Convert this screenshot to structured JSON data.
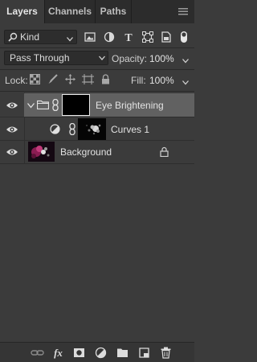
{
  "tabs": [
    {
      "label": "Layers",
      "active": true
    },
    {
      "label": "Channels",
      "active": false
    },
    {
      "label": "Paths",
      "active": false
    }
  ],
  "filter": {
    "kind_label": "Kind",
    "type_icons": [
      "image-filter-icon",
      "adjustment-filter-icon",
      "type-filter-icon",
      "shape-filter-icon",
      "smart-object-filter-icon",
      "filter-toggle"
    ]
  },
  "blend": {
    "mode": "Pass Through",
    "opacity_label": "Opacity:",
    "opacity_value": "100%"
  },
  "lock": {
    "label": "Lock:",
    "icons": [
      "lock-transparent-icon",
      "lock-image-icon",
      "lock-position-icon",
      "lock-artboard-icon",
      "lock-all-icon"
    ],
    "fill_label": "Fill:",
    "fill_value": "100%"
  },
  "layers": [
    {
      "name": "Eye Brightening",
      "type": "group",
      "selected": true
    },
    {
      "name": "Curves 1",
      "type": "adjustment"
    },
    {
      "name": "Background",
      "type": "image",
      "locked": true
    }
  ],
  "bottom_icons": [
    "link-layers-icon",
    "layer-style-fx-icon",
    "add-mask-icon",
    "new-adjustment-layer-icon",
    "new-group-icon",
    "new-layer-icon",
    "delete-layer-icon"
  ],
  "colors": {
    "panel": "#3b3b3b",
    "tabbar": "#2c2c2c",
    "selected_row": "#616161",
    "text": "#e2e2e2"
  }
}
